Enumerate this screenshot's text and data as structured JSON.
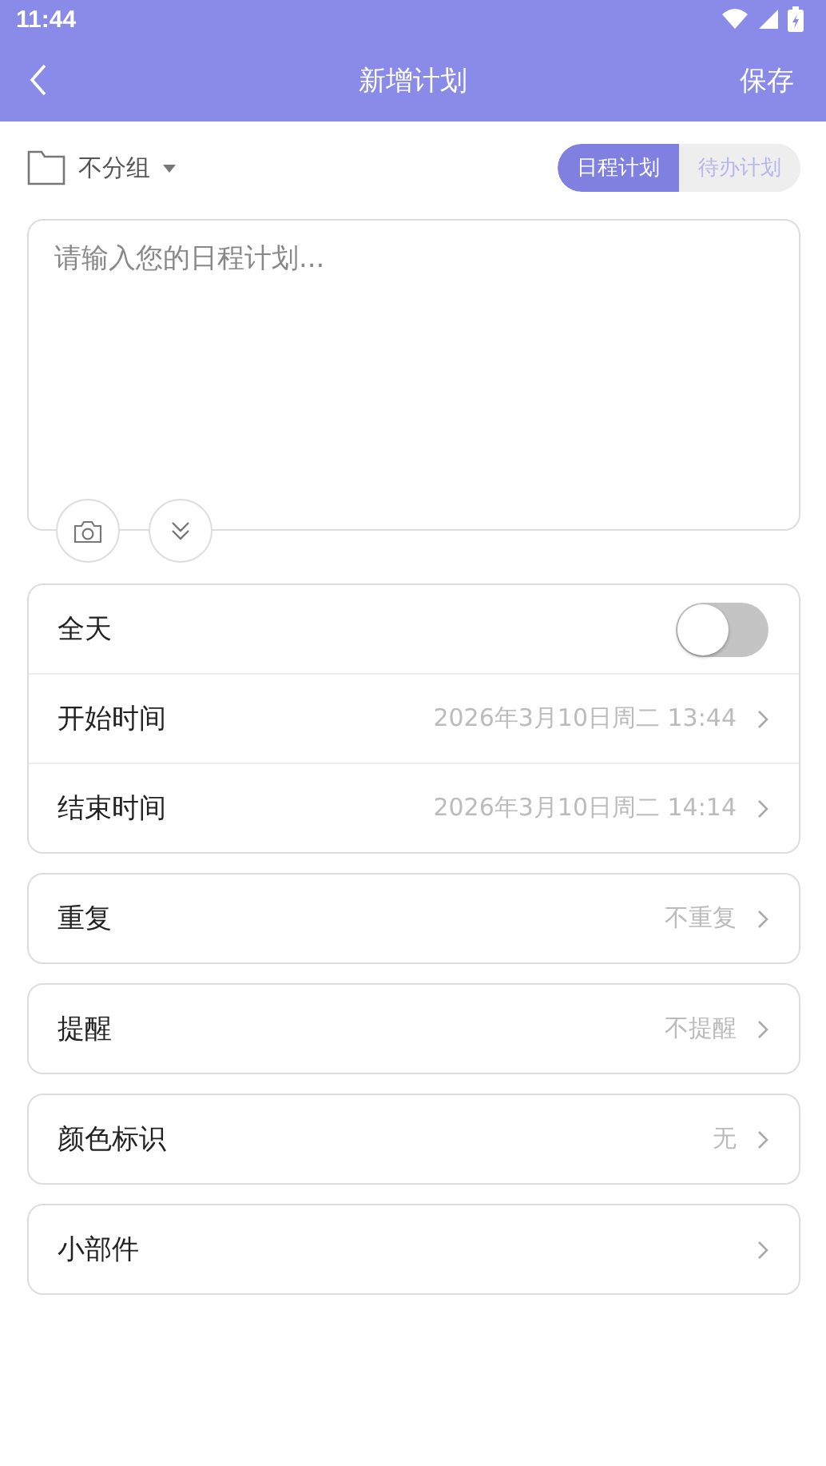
{
  "status_bar": {
    "time": "11:44"
  },
  "header": {
    "title": "新增计划",
    "action": "保存"
  },
  "group": {
    "label": "不分组"
  },
  "mode_tabs": [
    {
      "label": "日程计划",
      "selected": true
    },
    {
      "label": "待办计划",
      "selected": false
    }
  ],
  "editor": {
    "placeholder": "请输入您的日程计划..."
  },
  "time_card": [
    {
      "kind": "toggle",
      "label": "全天",
      "on": false
    },
    {
      "kind": "value",
      "label": "开始时间",
      "value": "2026年3月10日周二 13:44"
    },
    {
      "kind": "value",
      "label": "结束时间",
      "value": "2026年3月10日周二 14:14"
    }
  ],
  "settings": [
    {
      "label": "重复",
      "value": "不重复"
    },
    {
      "label": "提醒",
      "value": "不提醒"
    },
    {
      "label": "颜色标识",
      "value": "无"
    },
    {
      "label": "小部件"
    }
  ]
}
